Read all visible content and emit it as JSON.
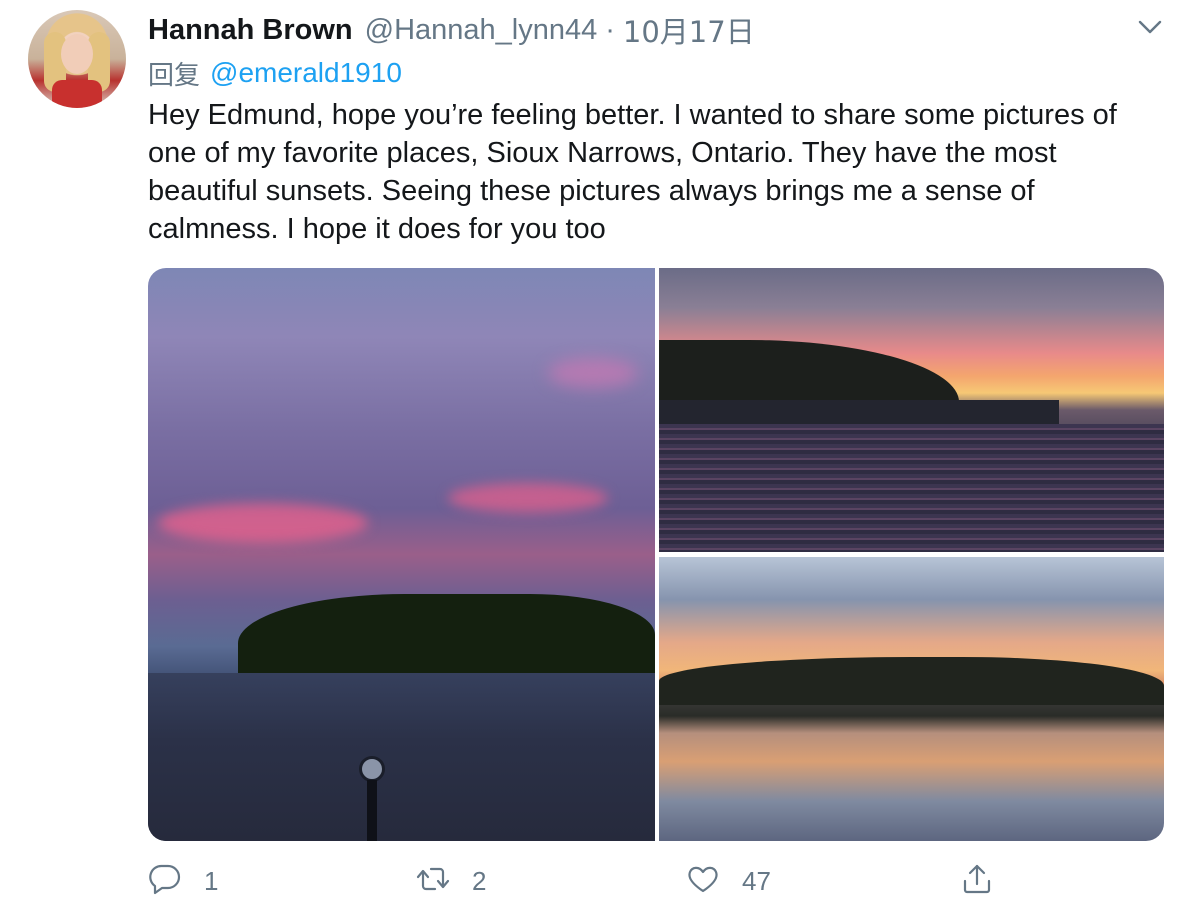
{
  "tweet": {
    "author": {
      "display_name": "Hannah Brown",
      "handle": "@Hannah_lynn44",
      "separator": "·",
      "date": "10月17日"
    },
    "reply": {
      "prefix": "回复",
      "to_handle": "@emerald1910"
    },
    "text": "Hey Edmund, hope you’re feeling better. I wanted to share some pictures of one of my favorite places, Sioux Narrows, Ontario. They have the most beautiful sunsets. Seeing these pictures always brings me a sense of calmness. I hope it does for you too",
    "media": [
      {
        "icon": "photo-purple-sky-lake"
      },
      {
        "icon": "photo-sunset-dock"
      },
      {
        "icon": "photo-sunset-reflection"
      }
    ],
    "actions": {
      "reply_count": "1",
      "retweet_count": "2",
      "like_count": "47"
    }
  },
  "icons": {
    "menu": "chevron-down-icon",
    "reply": "speech-bubble-icon",
    "retweet": "retweet-arrows-icon",
    "like": "heart-icon",
    "share": "share-upload-icon"
  },
  "colors": {
    "link": "#1da1f2",
    "muted": "#657786",
    "text": "#14171a"
  }
}
